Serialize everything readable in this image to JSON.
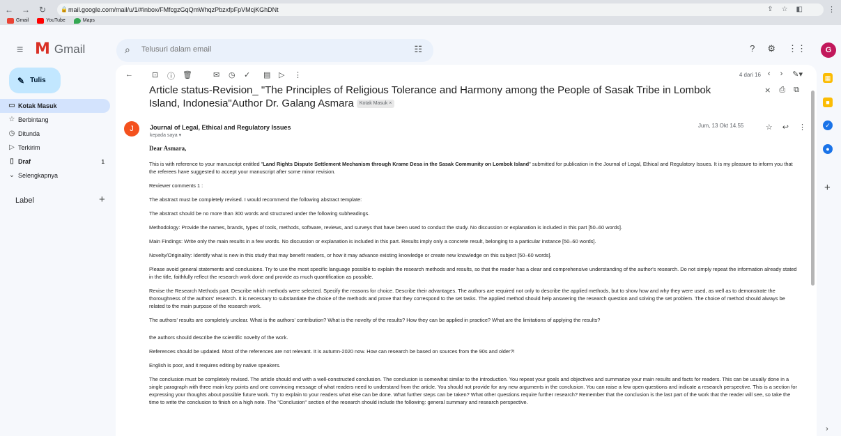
{
  "browser": {
    "url": "mail.google.com/mail/u/1/#inbox/FMfcgzGqQmWhqzPbzxfpFpVMcjKGhDNt",
    "bookmarks": [
      {
        "label": "Gmail",
        "color": "#ea4335"
      },
      {
        "label": "YouTube",
        "color": "#ff0000"
      },
      {
        "label": "Maps",
        "color": "#34a853"
      }
    ]
  },
  "app": {
    "name": "Gmail",
    "brand_color": "#d93025",
    "search_placeholder": "Telusuri dalam email",
    "avatar_letter": "G"
  },
  "sidebar": {
    "compose_label": "Tulis",
    "items": [
      {
        "label": "Kotak Masuk",
        "icon": "inbox-icon",
        "count": ""
      },
      {
        "label": "Berbintang",
        "icon": "star-icon",
        "count": ""
      },
      {
        "label": "Ditunda",
        "icon": "clock-icon",
        "count": ""
      },
      {
        "label": "Terkirim",
        "icon": "send-icon",
        "count": ""
      },
      {
        "label": "Draf",
        "icon": "draft-icon",
        "count": "1"
      },
      {
        "label": "Selengkapnya",
        "icon": "chevron-down-icon",
        "count": ""
      }
    ],
    "label_heading": "Label"
  },
  "toolbar": {
    "pager": "4 dari 16"
  },
  "email": {
    "subject": "Article status-Revision_ \"The Principles of Religious Tolerance and Harmony among the People of Sasak Tribe in Lombok Island, Indonesia\"Author Dr. Galang Asmara",
    "chip": "Kotak Masuk ×",
    "sender_initial": "J",
    "sender_name": "Journal of Legal, Ethical and Regulatory Issues",
    "to_line": "kepada saya ▾",
    "date": "Jum, 13 Okt 14.55",
    "greeting": "Dear Asmara,",
    "intro_before": "This is with reference to your manuscript entitled \"",
    "intro_title": "Land Rights Dispute Settlement Mechanism through Krame Desa in the Sasak Community on Lombok Island",
    "intro_after": "\" submitted for publication in the Journal of Legal, Ethical and Regulatory Issues. It is my pleasure to inform you that the referees have suggested to accept your manuscript after some minor revision.",
    "paragraphs": [
      "Reviewer comments 1 :",
      "The abstract must be completely revised. I would recommend the following abstract template:",
      "The abstract should be no more than 300 words and structured under the following subheadings.",
      " Methodology: Provide the names, brands, types of tools, methods, software, reviews, and surveys that have been used to conduct the study. No discussion or explanation is included in this part [50–60 words].",
      "Main Findings: Write only the main results in a few words. No discussion or explanation is included in this part. Results imply only a concrete result, belonging to a particular instance [50–60 words].",
      "Novelty/Originality: Identify what is new in this study that may benefit readers, or how it may advance existing knowledge or create new knowledge on this subject [50–60 words].",
      "Please avoid general statements and conclusions. Try to use the most specific language possible to explain the research methods and results, so that the reader has a clear and comprehensive understanding of the author's research. Do not simply repeat the information already stated in the title, faithfully reflect the research work done and provide as much quantification as possible.",
      " Revise the Research Methods part. Describe which methods were selected. Specify the reasons for choice. Describe their advantages. The authors are required not only to describe the applied methods, but to show how and why they were used, as well as to demonstrate the thoroughness of the authors' research. It is necessary to substantiate the choice of the methods and prove that they correspond to the set tasks. The applied method should help answering the research question and solving the set problem. The choice of method should always be related to the main purpose of the research work.",
      " The authors' results are completely unclear. What is the authors' contribution? What is the novelty of the results? How they can be applied in practice? What are the limitations of applying the results?",
      "the authors should describe the scientific novelty of the work.",
      "References should be updated. Most of the references are not relevant. It is autumn-2020 now. How can research be based on sources from the 90s and older?!",
      "English is poor, and it requires editing by native speakers.",
      "The conclusion must be completely revised. The article should end with a well-constructed conclusion. The conclusion is somewhat similar to the introduction. You repeat your goals and objectives and summarize your main results and facts for readers. This can be usually done in a single paragraph with three main key points and one convincing message of what readers need to understand from the article. You should not provide for any new arguments in the conclusion. You can raise a few open questions and indicate a research perspective. This is a section for expressing your thoughts about possible future work. Try to explain to your readers what else can be done. What further steps can be taken? What other questions require further research? Remember that the conclusion is the last part of the work that the reader will see, so take the time to write the conclusion to finish on a high note. The \"Conclusion\" section of the research should include the following: general summary and research perspective."
    ]
  }
}
